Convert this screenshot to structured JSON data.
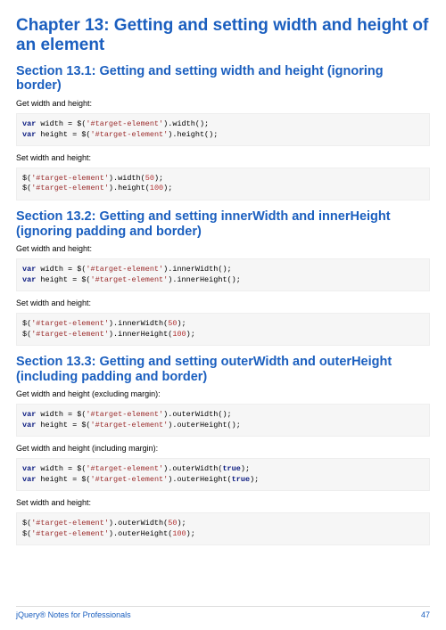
{
  "chapter": {
    "title": "Chapter 13: Getting and setting width and height of an element"
  },
  "sections": [
    {
      "title": "Section 13.1: Getting and setting width and height (ignoring border)",
      "blocks": [
        {
          "type": "para",
          "text": "Get width and height:"
        },
        {
          "type": "code",
          "tokens": [
            {
              "t": "kw",
              "v": "var"
            },
            {
              "t": "",
              "v": " width = $("
            },
            {
              "t": "str",
              "v": "'#target-element'"
            },
            {
              "t": "",
              "v": ").width();\n"
            },
            {
              "t": "kw",
              "v": "var"
            },
            {
              "t": "",
              "v": " height = $("
            },
            {
              "t": "str",
              "v": "'#target-element'"
            },
            {
              "t": "",
              "v": ").height();"
            }
          ]
        },
        {
          "type": "para",
          "text": "Set width and height:"
        },
        {
          "type": "code",
          "tokens": [
            {
              "t": "",
              "v": "$("
            },
            {
              "t": "str",
              "v": "'#target-element'"
            },
            {
              "t": "",
              "v": ").width("
            },
            {
              "t": "num",
              "v": "50"
            },
            {
              "t": "",
              "v": ");\n"
            },
            {
              "t": "",
              "v": "$("
            },
            {
              "t": "str",
              "v": "'#target-element'"
            },
            {
              "t": "",
              "v": ").height("
            },
            {
              "t": "num",
              "v": "100"
            },
            {
              "t": "",
              "v": ");"
            }
          ]
        }
      ]
    },
    {
      "title": "Section 13.2: Getting and setting innerWidth and innerHeight (ignoring padding and border)",
      "blocks": [
        {
          "type": "para",
          "text": "Get width and height:"
        },
        {
          "type": "code",
          "tokens": [
            {
              "t": "kw",
              "v": "var"
            },
            {
              "t": "",
              "v": " width = $("
            },
            {
              "t": "str",
              "v": "'#target-element'"
            },
            {
              "t": "",
              "v": ").innerWidth();\n"
            },
            {
              "t": "kw",
              "v": "var"
            },
            {
              "t": "",
              "v": " height = $("
            },
            {
              "t": "str",
              "v": "'#target-element'"
            },
            {
              "t": "",
              "v": ").innerHeight();"
            }
          ]
        },
        {
          "type": "para",
          "text": "Set width and height:"
        },
        {
          "type": "code",
          "tokens": [
            {
              "t": "",
              "v": "$("
            },
            {
              "t": "str",
              "v": "'#target-element'"
            },
            {
              "t": "",
              "v": ").innerWidth("
            },
            {
              "t": "num",
              "v": "50"
            },
            {
              "t": "",
              "v": ");\n"
            },
            {
              "t": "",
              "v": "$("
            },
            {
              "t": "str",
              "v": "'#target-element'"
            },
            {
              "t": "",
              "v": ").innerHeight("
            },
            {
              "t": "num",
              "v": "100"
            },
            {
              "t": "",
              "v": ");"
            }
          ]
        }
      ]
    },
    {
      "title": "Section 13.3: Getting and setting outerWidth and outerHeight (including padding and border)",
      "blocks": [
        {
          "type": "para",
          "text": "Get width and height (excluding margin):"
        },
        {
          "type": "code",
          "tokens": [
            {
              "t": "kw",
              "v": "var"
            },
            {
              "t": "",
              "v": " width = $("
            },
            {
              "t": "str",
              "v": "'#target-element'"
            },
            {
              "t": "",
              "v": ").outerWidth();\n"
            },
            {
              "t": "kw",
              "v": "var"
            },
            {
              "t": "",
              "v": " height = $("
            },
            {
              "t": "str",
              "v": "'#target-element'"
            },
            {
              "t": "",
              "v": ").outerHeight();"
            }
          ]
        },
        {
          "type": "para",
          "text": "Get width and height (including margin):"
        },
        {
          "type": "code",
          "tokens": [
            {
              "t": "kw",
              "v": "var"
            },
            {
              "t": "",
              "v": " width = $("
            },
            {
              "t": "str",
              "v": "'#target-element'"
            },
            {
              "t": "",
              "v": ").outerWidth("
            },
            {
              "t": "lit",
              "v": "true"
            },
            {
              "t": "",
              "v": ");\n"
            },
            {
              "t": "kw",
              "v": "var"
            },
            {
              "t": "",
              "v": " height = $("
            },
            {
              "t": "str",
              "v": "'#target-element'"
            },
            {
              "t": "",
              "v": ").outerHeight("
            },
            {
              "t": "lit",
              "v": "true"
            },
            {
              "t": "",
              "v": ");"
            }
          ]
        },
        {
          "type": "para",
          "text": "Set width and height:"
        },
        {
          "type": "code",
          "tokens": [
            {
              "t": "",
              "v": "$("
            },
            {
              "t": "str",
              "v": "'#target-element'"
            },
            {
              "t": "",
              "v": ").outerWidth("
            },
            {
              "t": "num",
              "v": "50"
            },
            {
              "t": "",
              "v": ");\n"
            },
            {
              "t": "",
              "v": "$("
            },
            {
              "t": "str",
              "v": "'#target-element'"
            },
            {
              "t": "",
              "v": ").outerHeight("
            },
            {
              "t": "num",
              "v": "100"
            },
            {
              "t": "",
              "v": ");"
            }
          ]
        }
      ]
    }
  ],
  "footer": {
    "left": "jQuery® Notes for Professionals",
    "right": "47"
  }
}
